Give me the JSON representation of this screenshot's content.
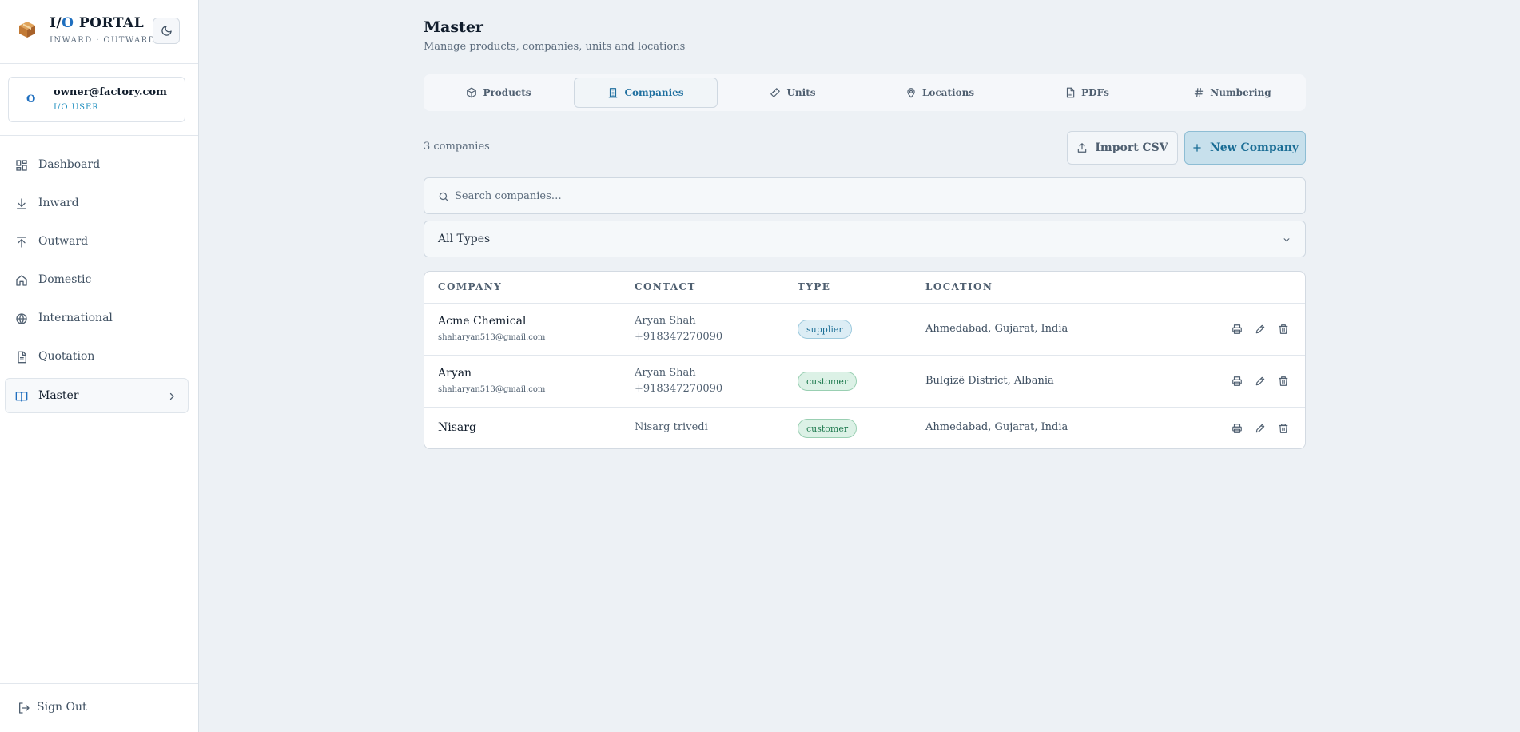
{
  "brand": {
    "title_prefix": "I/",
    "title_accent": "O",
    "title_suffix": " PORTAL",
    "subtitle": "INWARD · OUTWARD",
    "logo_icon": "package-box-icon",
    "theme_icon": "moon-icon"
  },
  "user": {
    "avatar_initial": "O",
    "email": "owner@factory.com",
    "role": "I/O USER"
  },
  "nav": {
    "items": [
      {
        "label": "Dashboard",
        "icon": "dashboard-grid-icon"
      },
      {
        "label": "Inward",
        "icon": "arrow-down-to-line-icon"
      },
      {
        "label": "Outward",
        "icon": "arrow-up-from-line-icon"
      },
      {
        "label": "Domestic",
        "icon": "home-icon"
      },
      {
        "label": "International",
        "icon": "globe-icon"
      },
      {
        "label": "Quotation",
        "icon": "document-icon"
      },
      {
        "label": "Master",
        "icon": "book-open-icon",
        "active": true
      }
    ],
    "sign_out": "Sign Out"
  },
  "page": {
    "title": "Master",
    "subtitle": "Manage products, companies, units and locations"
  },
  "tabs": [
    {
      "label": "Products",
      "icon": "cube-icon"
    },
    {
      "label": "Companies",
      "icon": "building-icon",
      "active": true
    },
    {
      "label": "Units",
      "icon": "ruler-icon"
    },
    {
      "label": "Locations",
      "icon": "map-pin-icon"
    },
    {
      "label": "PDFs",
      "icon": "file-icon"
    },
    {
      "label": "Numbering",
      "icon": "hash-icon"
    }
  ],
  "toolbar": {
    "count_label": "3 companies",
    "import_label": "Import CSV",
    "new_label": "New Company"
  },
  "search": {
    "placeholder": "Search companies…"
  },
  "filter": {
    "selected": "All Types"
  },
  "table": {
    "headers": {
      "company": "COMPANY",
      "contact": "CONTACT",
      "type": "TYPE",
      "location": "LOCATION"
    },
    "rows": [
      {
        "company": "Acme Chemical",
        "email": "shaharyan513@gmail.com",
        "contact": "Aryan Shah",
        "phone": "+918347270090",
        "type": "supplier",
        "location": "Ahmedabad, Gujarat, India"
      },
      {
        "company": "Aryan",
        "email": "shaharyan513@gmail.com",
        "contact": "Aryan Shah",
        "phone": "+918347270090",
        "type": "customer",
        "location": "Bulqizë District, Albania"
      },
      {
        "company": "Nisarg",
        "email": "",
        "contact": "Nisarg trivedi",
        "phone": "",
        "type": "customer",
        "location": "Ahmedabad, Gujarat, India"
      }
    ]
  },
  "colors": {
    "accent": "#1f6fbf",
    "primary_button_bg": "#c7e0ec",
    "supplier_badge": "#dcedf5",
    "customer_badge": "#dcf1e6",
    "page_bg": "#edf1f5"
  }
}
